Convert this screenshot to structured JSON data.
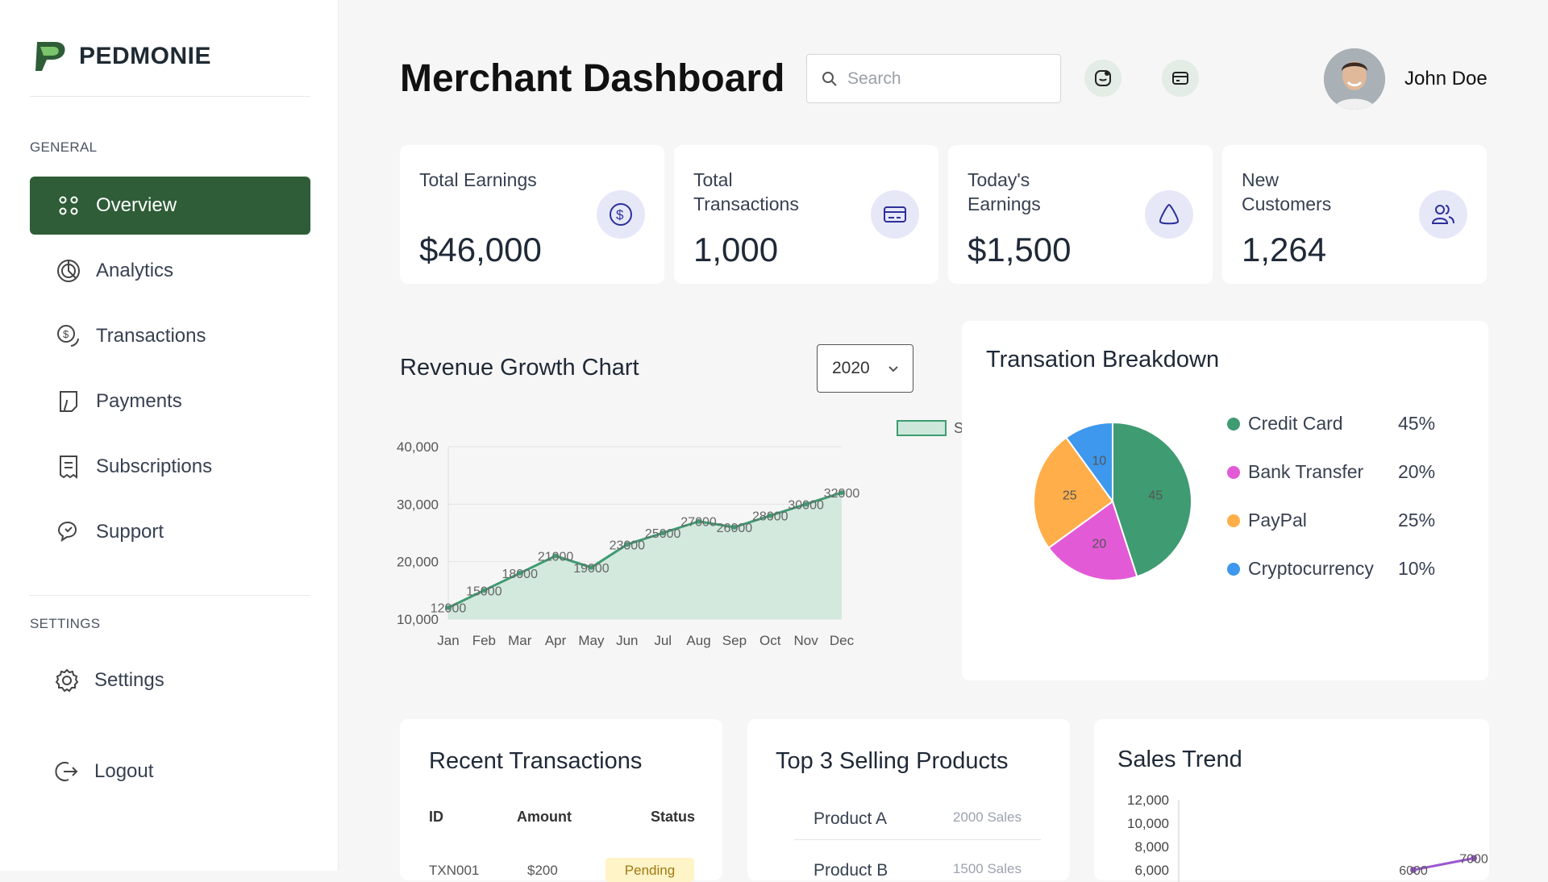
{
  "app": {
    "brand": "PEDMONIE",
    "brand_color": "#2e5d37"
  },
  "sidebar": {
    "general_label": "GENERAL",
    "settings_label": "SETTINGS",
    "items": [
      {
        "label": "Overview",
        "icon": "grid-dots-icon",
        "active": true
      },
      {
        "label": "Analytics",
        "icon": "analytics-icon"
      },
      {
        "label": "Transactions",
        "icon": "dollar-coin-icon"
      },
      {
        "label": "Payments",
        "icon": "payments-icon"
      },
      {
        "label": "Subscriptions",
        "icon": "receipt-icon"
      },
      {
        "label": "Support",
        "icon": "chat-bubbles-icon"
      }
    ],
    "settings": {
      "label": "Settings",
      "icon": "gear-icon"
    },
    "logout": {
      "label": "Logout",
      "icon": "logout-icon"
    }
  },
  "header": {
    "title": "Merchant Dashboard",
    "search_placeholder": "Search",
    "user_name": "John Doe"
  },
  "stats": [
    {
      "label": "Total Earnings",
      "value": "$46,000",
      "icon": "dollar-circle-icon"
    },
    {
      "label": "Total Transactions",
      "value": "1,000",
      "icon": "card-icon"
    },
    {
      "label": "Today's Earnings",
      "value": "$1,500",
      "icon": "triangle-icon"
    },
    {
      "label": "New Customers",
      "value": "1,264",
      "icon": "users-icon"
    }
  ],
  "revenue": {
    "title": "Revenue Growth Chart",
    "year": "2020"
  },
  "breakdown": {
    "title": "Transation Breakdown",
    "items": [
      {
        "label": "Credit Card",
        "pct": "45%",
        "color": "#3f9b71"
      },
      {
        "label": "Bank Transfer",
        "pct": "20%",
        "color": "#e35ad6"
      },
      {
        "label": "PayPal",
        "pct": "25%",
        "color": "#ffae4a"
      },
      {
        "label": "Cryptocurrency",
        "pct": "10%",
        "color": "#3d98ee"
      }
    ]
  },
  "recent": {
    "title": "Recent Transactions",
    "headers": [
      "ID",
      "Amount",
      "Status"
    ],
    "rows": [
      {
        "id": "TXN001",
        "amount": "$200",
        "status": "Pending"
      }
    ]
  },
  "top_products": {
    "title": "Top 3 Selling Products",
    "rows": [
      {
        "name": "Product A",
        "sales": "2000 Sales"
      },
      {
        "name": "Product B",
        "sales": "1500 Sales"
      }
    ]
  },
  "sales_trend": {
    "title": "Sales Trend"
  },
  "chart_data": [
    {
      "type": "area",
      "title": "",
      "legend": [
        "Sales"
      ],
      "legend_position": "top",
      "categories": [
        "Jan",
        "Feb",
        "Mar",
        "Apr",
        "May",
        "Jun",
        "Jul",
        "Aug",
        "Sep",
        "Oct",
        "Nov",
        "Dec"
      ],
      "series": [
        {
          "name": "Sales",
          "values": [
            12000,
            15000,
            18000,
            21000,
            19000,
            23000,
            25000,
            27000,
            26000,
            28000,
            30000,
            32000
          ],
          "color": "#3f9b71"
        }
      ],
      "ylim": [
        10000,
        40000
      ],
      "yticks": [
        "10,000",
        "20,000",
        "30,000",
        "40,000"
      ],
      "grid": true
    },
    {
      "type": "pie",
      "labels": [
        "Credit Card",
        "Bank Transfer",
        "PayPal",
        "Cryptocurrency"
      ],
      "values": [
        45,
        20,
        25,
        10
      ],
      "colors": [
        "#3f9b71",
        "#e35ad6",
        "#ffae4a",
        "#3d98ee"
      ]
    },
    {
      "type": "line",
      "title": "",
      "yticks": [
        "6,000",
        "8,000",
        "10,000",
        "12,000"
      ],
      "visible_values": [
        6000,
        7000
      ],
      "color": "#9b59d0"
    }
  ]
}
